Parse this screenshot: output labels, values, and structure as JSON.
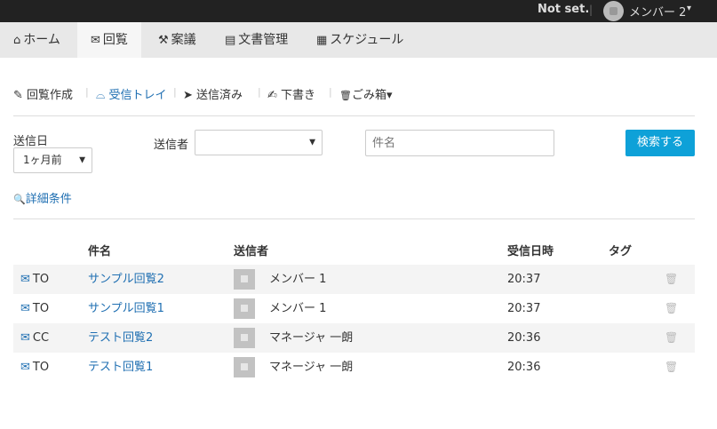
{
  "topbar": {
    "org": "Not set.",
    "separator": "|",
    "user": "メンバー 2",
    "caret": "▾"
  },
  "nav": {
    "tabs": [
      {
        "icon": "⌂",
        "label": "ホーム"
      },
      {
        "icon": "✉",
        "label": "回覧"
      },
      {
        "icon": "⚒",
        "label": "案議"
      },
      {
        "icon": "▤",
        "label": "文書管理"
      },
      {
        "icon": "▦",
        "label": "スケジュール"
      }
    ]
  },
  "actions": {
    "create": {
      "icon": "✎",
      "label": "回覧作成"
    },
    "inbox": {
      "icon": "⌓",
      "label": "受信トレイ"
    },
    "sent": {
      "icon": "➤",
      "label": "送信済み"
    },
    "draft": {
      "icon": "✍",
      "label": "下書き"
    },
    "trash": {
      "icon": "🗑",
      "label": "ごみ箱",
      "caret": "▾"
    },
    "divider": "|"
  },
  "search": {
    "date_label": "送信日",
    "date_value": "1ヶ月前",
    "sender_label": "送信者",
    "sender_value": "",
    "subject_placeholder": "件名",
    "submit_label": "検索する",
    "advanced_icon": "🔍",
    "advanced_label": "詳細条件",
    "arrow": "▼"
  },
  "table": {
    "headers": {
      "subject": "件名",
      "sender": "送信者",
      "received": "受信日時",
      "tag": "タグ"
    },
    "rows": [
      {
        "type": "TO",
        "subject": "サンプル回覧2",
        "sender": "メンバー 1",
        "time": "20:37"
      },
      {
        "type": "TO",
        "subject": "サンプル回覧1",
        "sender": "メンバー 1",
        "time": "20:37"
      },
      {
        "type": "CC",
        "subject": "テスト回覧2",
        "sender": "マネージャ 一朗",
        "time": "20:36"
      },
      {
        "type": "TO",
        "subject": "テスト回覧1",
        "sender": "マネージャ 一朗",
        "time": "20:36"
      }
    ],
    "envelope_icon": "✉",
    "trash_icon": "🗑"
  },
  "colors": {
    "accent": "#1f6fb2",
    "button": "#0ea1d8",
    "topbar": "#222222",
    "nav": "#e8e8e8"
  }
}
